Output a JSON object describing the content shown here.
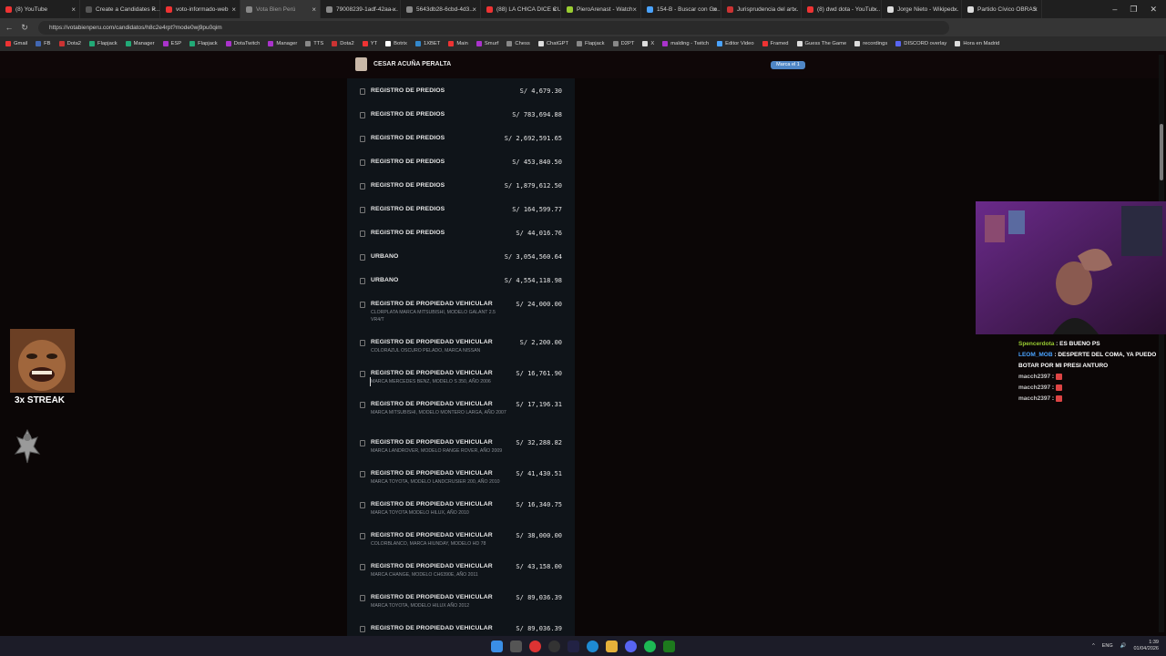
{
  "tabs": [
    {
      "label": "(8) YouTube",
      "color": "#e33"
    },
    {
      "label": "Create a Candidates P...",
      "color": "#555"
    },
    {
      "label": "voto-informado-web",
      "color": "#e33"
    },
    {
      "label": "Vota Bien Perú",
      "color": "#888",
      "active": true
    },
    {
      "label": "79008239-1adf-42aa-...",
      "color": "#888"
    },
    {
      "label": "5643db28-6cbd-4d3...",
      "color": "#888"
    },
    {
      "label": "(88) LA CHICA DICE CU...",
      "color": "#e33"
    },
    {
      "label": "PieroArenast - Watch",
      "color": "#9acd32"
    },
    {
      "label": "154-B - Buscar con Go...",
      "color": "#4aa3ff"
    },
    {
      "label": "Jurisprudencia del art...",
      "color": "#c33"
    },
    {
      "label": "(8) dwd dota - YouTub...",
      "color": "#e33"
    },
    {
      "label": "Jorge Nieto - Wikiped...",
      "color": "#ddd"
    },
    {
      "label": "Partido Cívico OBRAS",
      "color": "#ddd"
    }
  ],
  "address": {
    "url": "https://votabienperu.com/candidatos/h8c2e4rpt?mode0wj9pu0qim"
  },
  "bookmarks": [
    "Gmail",
    "FB",
    "Dota2",
    "Flapjack",
    "Manager",
    "ESP",
    "Flapjack",
    "DotaTwitch",
    "Manager",
    "TTS",
    "Dota2",
    "YT",
    "Botrix",
    "1XBET",
    "Main",
    "Smurf",
    "Chess",
    "ChatGPT",
    "Flapjack",
    "D2PT",
    "X",
    "malding - Twitch",
    "Editor Video",
    "Framed",
    "Guess The Game",
    "recordings",
    "DISCORD overlay",
    "Hora en Madrid"
  ],
  "candidate": {
    "name": "CESAR ACUÑA PERALTA",
    "badge": "Marca el 1"
  },
  "items": [
    {
      "title": "REGISTRO DE PREDIOS",
      "sub": "",
      "amount": "S/ 4,679.30"
    },
    {
      "title": "REGISTRO DE PREDIOS",
      "sub": "",
      "amount": "S/ 783,694.88"
    },
    {
      "title": "REGISTRO DE PREDIOS",
      "sub": "",
      "amount": "S/ 2,692,591.65"
    },
    {
      "title": "REGISTRO DE PREDIOS",
      "sub": "",
      "amount": "S/ 453,840.50"
    },
    {
      "title": "REGISTRO DE PREDIOS",
      "sub": "",
      "amount": "S/ 1,879,612.50"
    },
    {
      "title": "REGISTRO DE PREDIOS",
      "sub": "",
      "amount": "S/ 164,599.77"
    },
    {
      "title": "REGISTRO DE PREDIOS",
      "sub": "",
      "amount": "S/ 44,016.76"
    },
    {
      "title": "URBANO",
      "sub": "",
      "amount": "S/ 3,054,560.64"
    },
    {
      "title": "URBANO",
      "sub": "",
      "amount": "S/ 4,554,118.98"
    },
    {
      "title": "REGISTRO DE PROPIEDAD VEHICULAR",
      "sub": "CLORPLATA MARCA MITSUBISHI, MODELO GALANT 2.5 VR4/T",
      "amount": "S/ 24,000.00"
    },
    {
      "title": "REGISTRO DE PROPIEDAD VEHICULAR",
      "sub": "COLORAZUL OSCURO PELADO, MARCA NISSAN",
      "amount": "S/ 2,200.00"
    },
    {
      "title": "REGISTRO DE PROPIEDAD VEHICULAR",
      "sub": "MARCA MERCEDES BENZ, MODELO S 350, AÑO 2006",
      "amount": "S/ 16,761.90"
    },
    {
      "title": "REGISTRO DE PROPIEDAD VEHICULAR",
      "sub": "MARCA MITSUBISHI, MODELO MONTERO LARGA, AÑO 2007",
      "amount": "S/ 17,196.31"
    },
    {
      "title": "REGISTRO DE PROPIEDAD VEHICULAR",
      "sub": "MARCA LANDROVER, MODELO RANGE ROVER, AÑO 2009",
      "amount": "S/ 32,288.82"
    },
    {
      "title": "REGISTRO DE PROPIEDAD VEHICULAR",
      "sub": "MARCA TOYOTA, MODELO LANDCRUSIER 200, AÑO 2010",
      "amount": "S/ 41,430.51"
    },
    {
      "title": "REGISTRO DE PROPIEDAD VEHICULAR",
      "sub": "MARCA TOYOTA MODELO HILUX, AÑO 2010",
      "amount": "S/ 16,340.75"
    },
    {
      "title": "REGISTRO DE PROPIEDAD VEHICULAR",
      "sub": "COLORBLANCO, MARCA HIUNDAY, MODELO HD 78",
      "amount": "S/ 38,000.00"
    },
    {
      "title": "REGISTRO DE PROPIEDAD VEHICULAR",
      "sub": "MARCA CHANGE, MODELO CH6390E, AÑO 2011",
      "amount": "S/ 43,158.00"
    },
    {
      "title": "REGISTRO DE PROPIEDAD VEHICULAR",
      "sub": "MARCA TOYOTA, MODELO HILUX AÑO 2012",
      "amount": "S/ 89,036.39"
    },
    {
      "title": "REGISTRO DE PROPIEDAD VEHICULAR",
      "sub": "",
      "amount": "S/ 89,036.39"
    }
  ],
  "overlay": {
    "streak": "3x STREAK"
  },
  "chat": [
    {
      "user": "Spencerdota",
      "color": "g",
      "msg": "ES BUENO PS"
    },
    {
      "user": "LEOM_MOB",
      "color": "b",
      "msg": "DESPERTE DEL COMA, YA PUEDO BOTAR POR MI PRESI ANTURO"
    },
    {
      "user": "macch2397",
      "color": "",
      "msg": ""
    },
    {
      "user": "macch2397",
      "color": "",
      "msg": ""
    },
    {
      "user": "macch2397",
      "color": "",
      "msg": ""
    }
  ],
  "tray": {
    "lang": "ENG",
    "time": "1:39",
    "date": "01/04/2026"
  }
}
